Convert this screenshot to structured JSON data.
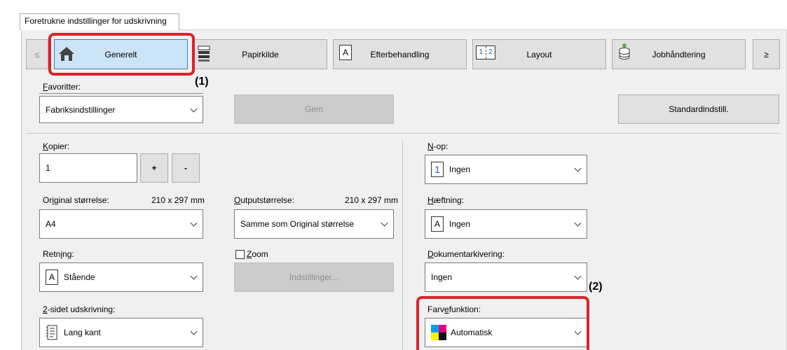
{
  "tab_header": "Foretrukne indstillinger for udskrivning",
  "nav": {
    "prev": "≤",
    "next": "≥"
  },
  "tabs": [
    {
      "label": "Generelt",
      "icon": "home-icon"
    },
    {
      "label": "Papirkilde",
      "icon": "paper-tray-icon"
    },
    {
      "label": "Efterbehandling",
      "icon": "finishing-icon"
    },
    {
      "label": "Layout",
      "icon": "layout-icon"
    },
    {
      "label": "Jobhåndtering",
      "icon": "job-handling-icon"
    }
  ],
  "favorites": {
    "label": "Favoritter:",
    "value": "Fabriksindstillinger",
    "save": "Gem",
    "default": "Standardindstill."
  },
  "copies": {
    "label": "Kopier:",
    "value": "1",
    "plus": "+",
    "minus": "-"
  },
  "original_size": {
    "label": "Original størrelse:",
    "dims": "210 x 297 mm",
    "value": "A4"
  },
  "output_size": {
    "label": "Outputstørrelse:",
    "dims": "210 x 297 mm",
    "value": "Samme som Original størrelse"
  },
  "orientation": {
    "label": "Retning:",
    "value": "Stående",
    "icon_letter": "A"
  },
  "zoom": {
    "label": "Zoom",
    "checked": false,
    "settings": "Indstillinger..."
  },
  "duplex": {
    "label": "2-sidet udskrivning:",
    "value": "Lang kant"
  },
  "n_up": {
    "label": "N-op:",
    "value": "Ingen",
    "icon_num": "1"
  },
  "stapling": {
    "label": "Hæftning:",
    "value": "Ingen",
    "icon_letter": "A"
  },
  "doc_filing": {
    "label": "Dokumentarkivering:",
    "value": "Ingen"
  },
  "color_mode": {
    "label": "Farvefunktion:",
    "value": "Automatisk"
  },
  "annotations": {
    "a1": "(1)",
    "a2": "(2)"
  },
  "colors": {
    "highlight": "#d9232d",
    "selected_tab": "#cce4f7",
    "panel": "#f0f0f0"
  }
}
